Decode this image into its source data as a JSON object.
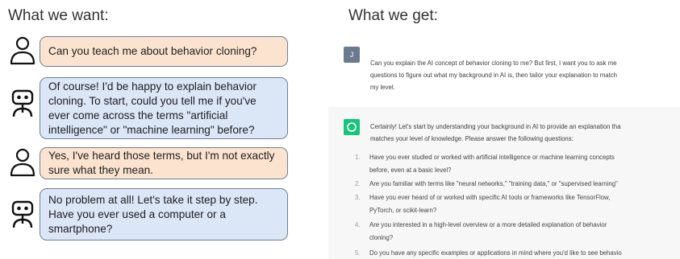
{
  "left": {
    "heading": "What we want:",
    "messages": [
      {
        "role": "user",
        "icon": "person-icon",
        "text": "Can you teach me about behavior cloning?"
      },
      {
        "role": "bot",
        "icon": "robot-icon",
        "text": "Of course! I'd be happy to explain behavior cloning. To start, could you tell me if you've ever come across the terms \"artificial intelligence\" or \"machine learning\" before?"
      },
      {
        "role": "user",
        "icon": "person-icon",
        "text": "Yes, I've heard those terms, but I'm not exactly sure what they mean."
      },
      {
        "role": "bot",
        "icon": "robot-icon",
        "text": "No problem at all! Let's take it step by step. Have you ever used a computer or a smartphone?"
      }
    ]
  },
  "right": {
    "heading": "What we get:",
    "user_avatar_initial": "J",
    "prompt_lines": [
      "Can you explain the AI concept of behavior cloning to me? But first, I want you to ask me",
      "questions to figure out what my background in AI is, then tailor your explanation to match",
      "my level."
    ],
    "reply_intro": [
      "Certainly! Let's start by understanding your background in AI to provide an explanation tha",
      "matches your level of knowledge. Please answer the following questions:"
    ],
    "questions": [
      {
        "num": "1.",
        "lines": [
          "Have you ever studied or worked with artificial intelligence or machine learning concepts",
          "before, even at a basic level?"
        ]
      },
      {
        "num": "2.",
        "lines": [
          "Are you familiar with terms like \"neural networks,\" \"training data,\" or \"supervised learning\""
        ]
      },
      {
        "num": "3.",
        "lines": [
          "Have you ever heard of or worked with specific AI tools or frameworks like TensorFlow,",
          "PyTorch, or scikit-learn?"
        ]
      },
      {
        "num": "4.",
        "lines": [
          "Are you interested in a high-level overview or a more detailed explanation of behavior",
          "cloning?"
        ]
      },
      {
        "num": "5.",
        "lines": [
          "Do you have any specific examples or applications in mind where you'd like to see behavio"
        ]
      }
    ]
  },
  "colors": {
    "user_bubble": "#fbe3cf",
    "bot_bubble": "#dbe6f7",
    "bubble_border": "#6e7f95",
    "chat_user_avatar": "#6b7a8f",
    "chat_bot_avatar": "#19c37d",
    "answer_background": "#f7f7f8"
  }
}
